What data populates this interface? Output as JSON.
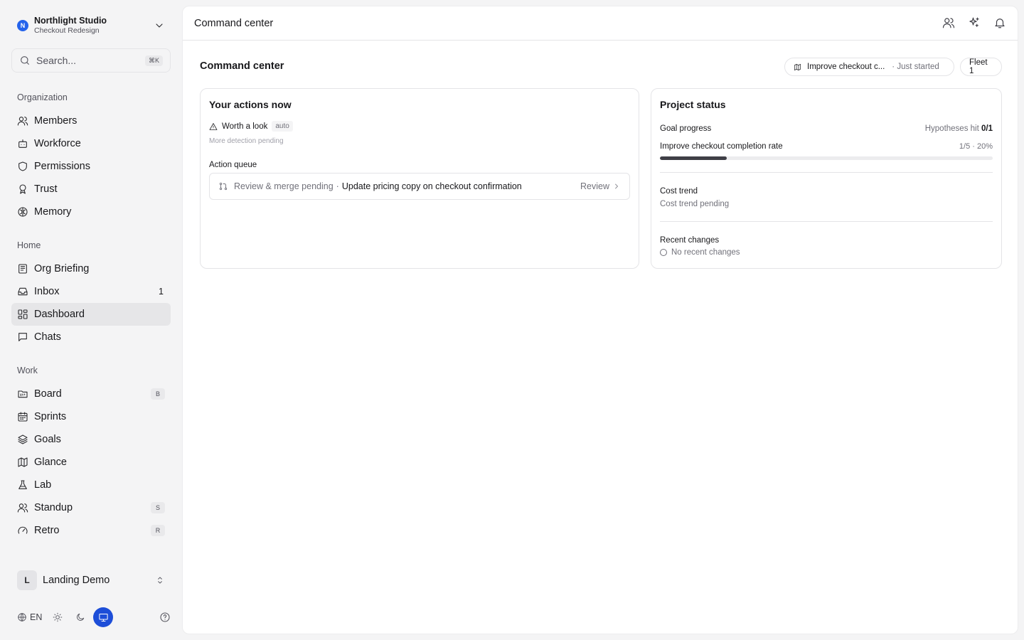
{
  "workspace": {
    "logo_letter": "N",
    "name": "Northlight Studio",
    "project": "Checkout Redesign"
  },
  "search": {
    "placeholder": "Search...",
    "shortcut": "⌘K"
  },
  "sidebar": {
    "sections": [
      {
        "title": "Organization",
        "items": [
          {
            "label": "Members",
            "icon": "users-icon"
          },
          {
            "label": "Workforce",
            "icon": "bot-icon"
          },
          {
            "label": "Permissions",
            "icon": "shield-icon"
          },
          {
            "label": "Trust",
            "icon": "award-icon"
          },
          {
            "label": "Memory",
            "icon": "brain-icon"
          }
        ]
      },
      {
        "title": "Home",
        "items": [
          {
            "label": "Org Briefing",
            "icon": "newspaper-icon"
          },
          {
            "label": "Inbox",
            "icon": "inbox-icon",
            "count": "1"
          },
          {
            "label": "Dashboard",
            "icon": "dashboard-icon",
            "active": true
          },
          {
            "label": "Chats",
            "icon": "chat-icon"
          }
        ]
      },
      {
        "title": "Work",
        "items": [
          {
            "label": "Board",
            "icon": "board-icon",
            "shortcut": "B"
          },
          {
            "label": "Sprints",
            "icon": "calendar-icon"
          },
          {
            "label": "Goals",
            "icon": "layers-icon"
          },
          {
            "label": "Glance",
            "icon": "map-icon"
          },
          {
            "label": "Lab",
            "icon": "flask-icon"
          },
          {
            "label": "Standup",
            "icon": "users-icon",
            "shortcut": "S"
          },
          {
            "label": "Retro",
            "icon": "gauge-icon",
            "shortcut": "R"
          }
        ]
      }
    ]
  },
  "user": {
    "initial": "L",
    "name": "Landing Demo"
  },
  "footer": {
    "language": "EN",
    "theme_selected": "system"
  },
  "topbar": {
    "title": "Command center"
  },
  "page": {
    "title": "Command center",
    "goal_pill": {
      "name": "Improve checkout c...",
      "status": "· Just started"
    },
    "fleet_pill": "Fleet 1"
  },
  "actions_card": {
    "title": "Your actions now",
    "worth_look": "Worth a look",
    "auto_badge": "auto",
    "detection_note": "More detection pending",
    "queue_title": "Action queue",
    "queue": [
      {
        "type": "Review & merge pending",
        "separator": "·",
        "title": "Update pricing copy on checkout confirmation",
        "action": "Review"
      }
    ]
  },
  "status_card": {
    "title": "Project status",
    "goal_progress_label": "Goal progress",
    "hypotheses_label": "Hypotheses hit",
    "hypotheses_value": "0/1",
    "goal_name": "Improve checkout completion rate",
    "goal_meta": "1/5 · 20%",
    "goal_progress_fraction": 0.2,
    "cost_trend_label": "Cost trend",
    "cost_trend_value": "Cost trend pending",
    "recent_changes_label": "Recent changes",
    "recent_changes_value": "No recent changes"
  },
  "colors": {
    "accent": "#1d4ed8",
    "logo": "#2563eb",
    "active_nav": "#e6e6e8",
    "progress_fill": "#3f3f46"
  }
}
